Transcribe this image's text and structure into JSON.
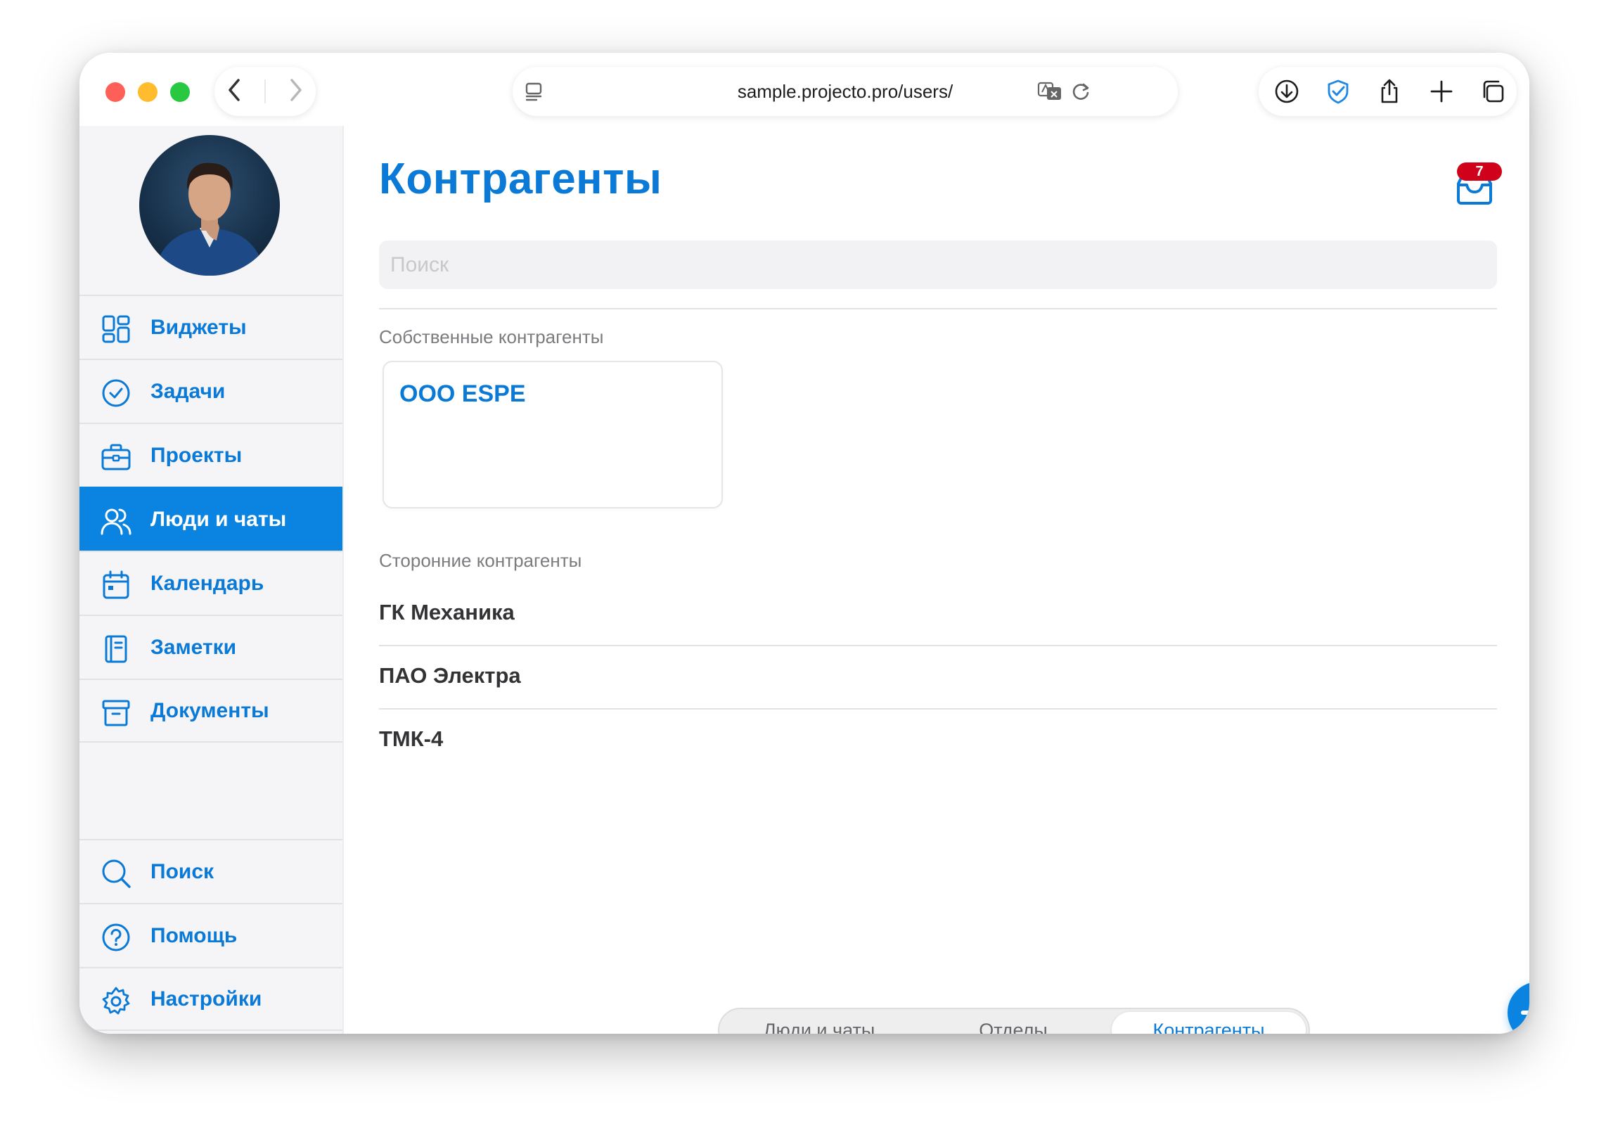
{
  "browser": {
    "url": "sample.projecto.pro/users/"
  },
  "sidebar": {
    "avatar_alt": "",
    "items": [
      {
        "label": "Виджеты",
        "icon": "widgets-icon"
      },
      {
        "label": "Задачи",
        "icon": "check-circle-icon"
      },
      {
        "label": "Проекты",
        "icon": "briefcase-icon"
      },
      {
        "label": "Люди и чаты",
        "icon": "people-icon",
        "active": true
      },
      {
        "label": "Календарь",
        "icon": "calendar-icon"
      },
      {
        "label": "Заметки",
        "icon": "notebook-icon"
      },
      {
        "label": "Документы",
        "icon": "archive-icon"
      }
    ],
    "bottom_items": [
      {
        "label": "Поиск",
        "icon": "search-icon"
      },
      {
        "label": "Помощь",
        "icon": "help-icon"
      },
      {
        "label": "Настройки",
        "icon": "gear-icon"
      }
    ]
  },
  "main": {
    "title": "Контрагенты",
    "inbox_badge": "7",
    "search_placeholder": "Поиск",
    "own_section_title": "Собственные контрагенты",
    "own_cards": [
      {
        "name": "ООО ESPE"
      }
    ],
    "external_section_title": "Сторонние контрагенты",
    "external_items": [
      {
        "name": "ГК Механика"
      },
      {
        "name": "ПАО Электра"
      },
      {
        "name": "ТМК-4"
      }
    ]
  },
  "segmented": {
    "tabs": [
      {
        "label": "Люди и чаты"
      },
      {
        "label": "Отделы"
      },
      {
        "label": "Контрагенты",
        "active": true
      }
    ]
  },
  "colors": {
    "accent": "#0a84e0",
    "accent_text": "#0a7ad6",
    "badge": "#d0021b"
  }
}
